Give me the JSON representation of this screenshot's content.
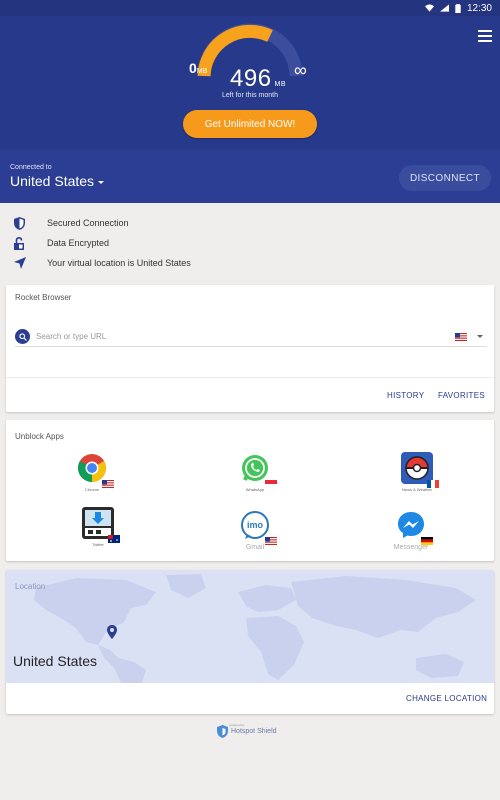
{
  "status_bar": {
    "time": "12:30"
  },
  "header": {
    "data_min": "0",
    "data_min_unit": "MB",
    "data_value": "496",
    "data_unit": "MB",
    "data_max": "∞",
    "caption": "Left for this month",
    "unlimited_button": "Get Unlimited NOW!",
    "accent_color": "#f79a1b",
    "bg_color": "#27398a"
  },
  "connection": {
    "label": "Connected to",
    "country": "United States",
    "disconnect_button": "DISCONNECT"
  },
  "status_items": [
    {
      "icon": "shield-icon",
      "text": "Secured Connection"
    },
    {
      "icon": "lock-icon",
      "text": "Data Encrypted"
    },
    {
      "icon": "navigation-icon",
      "text": "Your virtual location is United States"
    }
  ],
  "browser": {
    "title": "Rocket Browser",
    "search_placeholder": "Search or type URL",
    "history_button": "HISTORY",
    "favorites_button": "FAVORITES"
  },
  "apps": {
    "title": "Unblock Apps",
    "items": [
      {
        "name": "Chrome",
        "icon": "chrome-icon",
        "flag": "us"
      },
      {
        "name": "WhatsApp",
        "icon": "whatsapp-icon",
        "flag": "sg"
      },
      {
        "name": "News & Weather",
        "icon": "pokeball-icon",
        "flag": "fr"
      },
      {
        "name": "Twitter",
        "icon": "download-app-icon",
        "flag": "au"
      },
      {
        "name": "Gmail",
        "icon": "imo-icon",
        "flag": "us"
      },
      {
        "name": "Messenger",
        "icon": "messenger-icon",
        "flag": "de"
      }
    ]
  },
  "location": {
    "title": "Location",
    "country": "United States",
    "change_button": "CHANGE LOCATION"
  },
  "footer": {
    "brand": "Hotspot Shield",
    "powered_by": "powered by"
  }
}
